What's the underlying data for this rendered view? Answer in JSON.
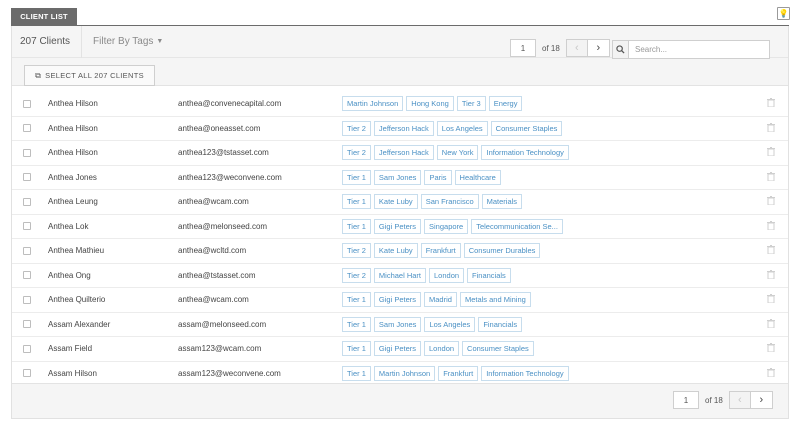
{
  "tab": {
    "label": "CLIENT LIST"
  },
  "header": {
    "count": "207 Clients",
    "filter_label": "Filter By Tags"
  },
  "toolbar": {
    "select_all_label": "SELECT ALL 207 CLIENTS"
  },
  "pager": {
    "page": "1",
    "of": "of 18"
  },
  "search": {
    "placeholder": "Search..."
  },
  "colors": {
    "tag_text": "#4a90c4",
    "tag_border": "#c7dded",
    "tab_bg": "#6b6b6b"
  },
  "icons": {
    "bulb": "lightbulb-icon",
    "search": "search-icon",
    "copy": "copy-icon",
    "trash": "trash-icon"
  },
  "rows": [
    {
      "name": "Anthea Hilson",
      "email": "anthea@convenecapital.com",
      "tags": [
        "Martin Johnson",
        "Hong Kong",
        "Tier 3",
        "Energy"
      ]
    },
    {
      "name": "Anthea Hilson",
      "email": "anthea@oneasset.com",
      "tags": [
        "Tier 2",
        "Jefferson Hack",
        "Los Angeles",
        "Consumer Staples"
      ]
    },
    {
      "name": "Anthea Hilson",
      "email": "anthea123@tstasset.com",
      "tags": [
        "Tier 2",
        "Jefferson Hack",
        "New York",
        "Information Technology"
      ]
    },
    {
      "name": "Anthea Jones",
      "email": "anthea123@weconvene.com",
      "tags": [
        "Tier 1",
        "Sam Jones",
        "Paris",
        "Healthcare"
      ]
    },
    {
      "name": "Anthea Leung",
      "email": "anthea@wcam.com",
      "tags": [
        "Tier 1",
        "Kate Luby",
        "San Francisco",
        "Materials"
      ]
    },
    {
      "name": "Anthea Lok",
      "email": "anthea@melonseed.com",
      "tags": [
        "Tier 1",
        "Gigi Peters",
        "Singapore",
        "Telecommunication Se..."
      ]
    },
    {
      "name": "Anthea Mathieu",
      "email": "anthea@wcltd.com",
      "tags": [
        "Tier 2",
        "Kate Luby",
        "Frankfurt",
        "Consumer Durables"
      ]
    },
    {
      "name": "Anthea Ong",
      "email": "anthea@tstasset.com",
      "tags": [
        "Tier 2",
        "Michael Hart",
        "London",
        "Financials"
      ]
    },
    {
      "name": "Anthea Quilterio",
      "email": "anthea@wcam.com",
      "tags": [
        "Tier 1",
        "Gigi Peters",
        "Madrid",
        "Metals and Mining"
      ]
    },
    {
      "name": "Assam Alexander",
      "email": "assam@melonseed.com",
      "tags": [
        "Tier 1",
        "Sam Jones",
        "Los Angeles",
        "Financials"
      ]
    },
    {
      "name": "Assam Field",
      "email": "assam123@wcam.com",
      "tags": [
        "Tier 1",
        "Gigi Peters",
        "London",
        "Consumer Staples"
      ]
    },
    {
      "name": "Assam Hilson",
      "email": "assam123@weconvene.com",
      "tags": [
        "Tier 1",
        "Martin Johnson",
        "Frankfurt",
        "Information Technology"
      ]
    }
  ]
}
